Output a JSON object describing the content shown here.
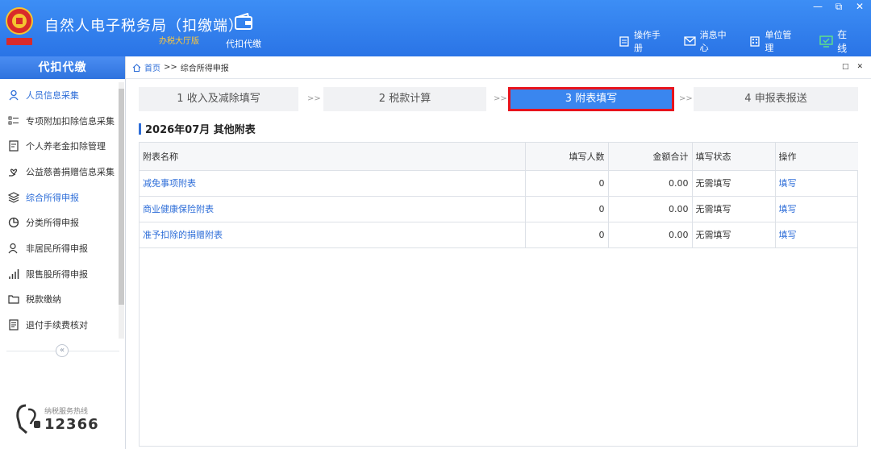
{
  "header": {
    "app_title": "自然人电子税务局（扣缴端）",
    "app_subtitle": "办税大厅版",
    "module_label": "代扣代缴",
    "links": [
      {
        "label": "操作手册",
        "icon": "manual-icon"
      },
      {
        "label": "消息中心",
        "icon": "mail-icon"
      },
      {
        "label": "单位管理",
        "icon": "building-icon"
      }
    ],
    "online_label": "在线",
    "window_controls": [
      "—",
      "⧉",
      "✕"
    ]
  },
  "sidebar": {
    "title": "代扣代缴",
    "items": [
      {
        "label": "人员信息采集",
        "icon": "person-icon",
        "active": true
      },
      {
        "label": "专项附加扣除信息采集",
        "icon": "list-icon"
      },
      {
        "label": "个人养老金扣除管理",
        "icon": "pension-icon"
      },
      {
        "label": "公益慈善捐赠信息采集",
        "icon": "donation-icon"
      },
      {
        "label": "综合所得申报",
        "icon": "layers-icon"
      },
      {
        "label": "分类所得申报",
        "icon": "pie-icon"
      },
      {
        "label": "非居民所得申报",
        "icon": "nonresident-icon"
      },
      {
        "label": "限售股所得申报",
        "icon": "stock-icon"
      },
      {
        "label": "税款缴纳",
        "icon": "folder-icon"
      },
      {
        "label": "退付手续费核对",
        "icon": "doc-icon"
      }
    ],
    "collapse": "«",
    "hotline_label": "纳税服务热线",
    "hotline_number": "12366"
  },
  "breadcrumb": {
    "home": "首页",
    "sep": ">>",
    "current": "综合所得申报"
  },
  "panel_controls": [
    "□",
    "✕"
  ],
  "steps": [
    {
      "label": "1 收入及减除填写",
      "active": false
    },
    {
      "label": "2 税款计算",
      "active": false
    },
    {
      "label": "3 附表填写",
      "active": true
    },
    {
      "label": "4 申报表报送",
      "active": false
    }
  ],
  "step_arrow": ">>",
  "section_title": "2026年07月  其他附表",
  "table": {
    "headers": [
      "附表名称",
      "填写人数",
      "金额合计",
      "填写状态",
      "操作"
    ],
    "rows": [
      {
        "name": "减免事项附表",
        "count": "0",
        "amount": "0.00",
        "status": "无需填写",
        "action": "填写"
      },
      {
        "name": "商业健康保险附表",
        "count": "0",
        "amount": "0.00",
        "status": "无需填写",
        "action": "填写"
      },
      {
        "name": "准予扣除的捐赠附表",
        "count": "0",
        "amount": "0.00",
        "status": "无需填写",
        "action": "填写"
      }
    ]
  },
  "colors": {
    "header_blue": "#2a74e6",
    "accent_blue": "#2e6ed8",
    "active_step": "#3a86ef",
    "highlight_red": "#e8131c",
    "subtitle_orange": "#ffc83a"
  }
}
